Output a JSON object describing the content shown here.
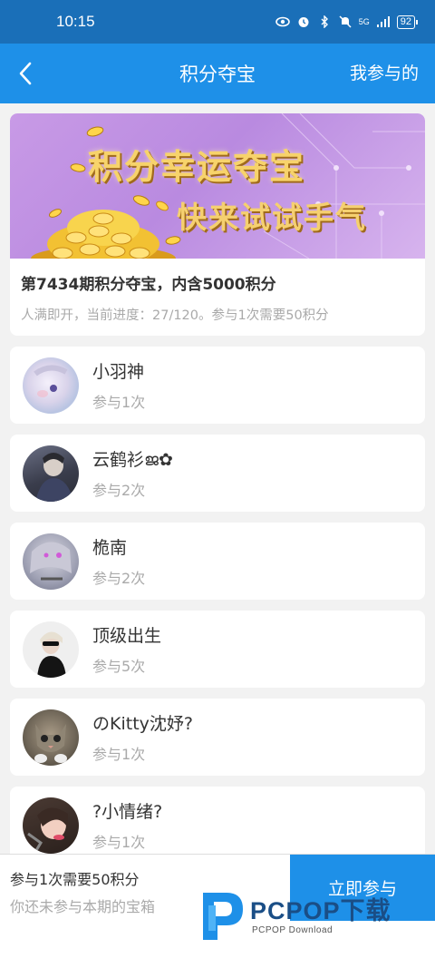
{
  "status_bar": {
    "time": "10:15",
    "net_label": "5G",
    "battery": "92",
    "icons": [
      "eye-icon",
      "alarm-icon",
      "bluetooth-icon",
      "mute-icon",
      "signal-icon",
      "battery-icon"
    ]
  },
  "header": {
    "title": "积分夺宝",
    "right_action": "我参与的",
    "background": "#1e90e8"
  },
  "banner": {
    "line1": "积分幸运夺宝",
    "line2": "快来试试手气"
  },
  "lottery": {
    "title": "第7434期积分夺宝，内含5000积分",
    "description": "人满即开，当前进度：27/120。参与1次需要50积分",
    "progress_current": 27,
    "progress_total": 120
  },
  "participants": [
    {
      "name": "小羽神",
      "count": "参与1次"
    },
    {
      "name": "云鹤衫ജ✿",
      "count": "参与2次"
    },
    {
      "name": "桅南",
      "count": "参与2次"
    },
    {
      "name": "顶级出生",
      "count": "参与5次"
    },
    {
      "name": "のKitty沈妤?",
      "count": "参与1次"
    },
    {
      "name": "?小情绪?",
      "count": "参与1次"
    }
  ],
  "bottom_bar": {
    "cost": "参与1次需要50积分",
    "status": "你还未参与本期的宝箱",
    "join_label": "立即参与"
  },
  "watermark": {
    "brand": "PCPOP下载",
    "sub": "PCPOP Download"
  }
}
